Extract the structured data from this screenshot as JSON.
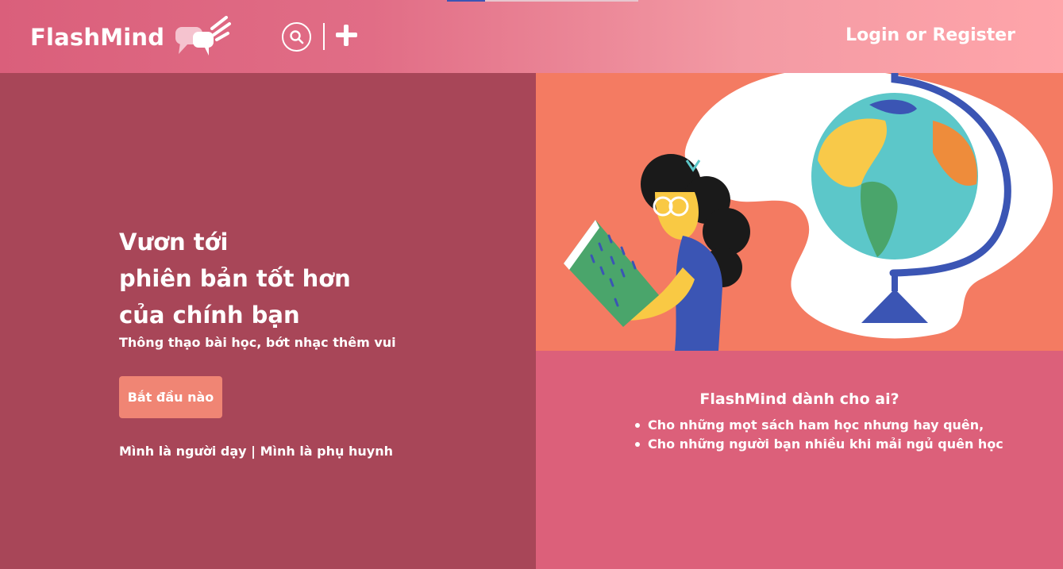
{
  "header": {
    "logo_text": "FlashMind",
    "login_text": "Login or Register",
    "icons": [
      "speech-bubbles-logo-icon",
      "search-icon",
      "plus-icon"
    ]
  },
  "hero": {
    "title_line1": "Vươn tới",
    "title_line2": "phiên bản tốt hơn",
    "title_line3": "của chính bạn",
    "subtitle": "Thông thạo bài học, bớt nhạc thêm vui",
    "start_button": "Bắt đầu nào",
    "teacher_link": "Mình là người dạy",
    "separator": " | ",
    "parent_link": "Mình là phụ huynh"
  },
  "audience": {
    "title": "FlashMind dành cho ai?",
    "items": [
      "Cho những mọt sách ham học nhưng hay quên,",
      "Cho những người bạn nhiều khi mải ngủ quên học"
    ]
  },
  "colors": {
    "header_start": "#da5f7b",
    "header_end": "#ffa5aa",
    "left_panel": "#a84658",
    "right_panel": "#dc607a",
    "button": "#f08574",
    "illustration_bg": "#f47b62"
  }
}
